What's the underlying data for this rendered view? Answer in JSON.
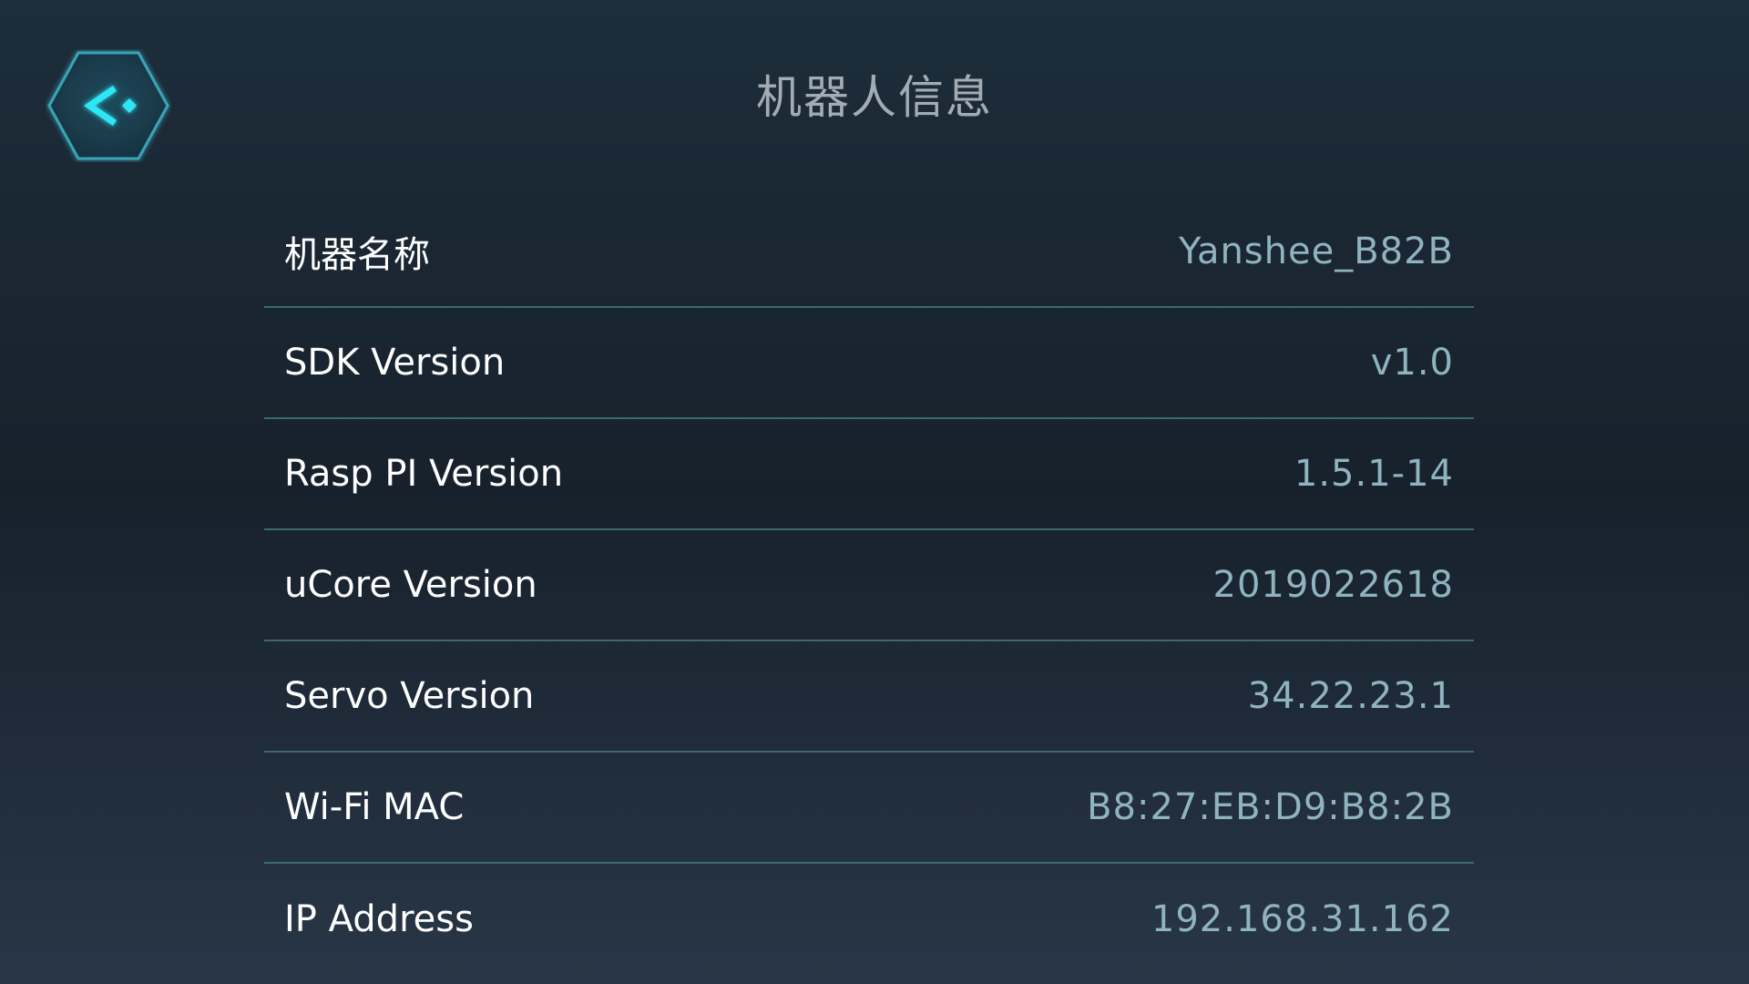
{
  "header": {
    "title": "机器人信息",
    "back_icon": "back-arrow-icon",
    "accent_color": "#2fe6f5"
  },
  "info": {
    "items": [
      {
        "label": "机器名称",
        "value": "Yanshee_B82B"
      },
      {
        "label": "SDK Version",
        "value": "v1.0"
      },
      {
        "label": "Rasp PI Version",
        "value": "1.5.1-14"
      },
      {
        "label": "uCore Version",
        "value": "2019022618"
      },
      {
        "label": "Servo Version",
        "value": "34.22.23.1"
      },
      {
        "label": "Wi-Fi MAC",
        "value": "B8:27:EB:D9:B8:2B"
      },
      {
        "label": "IP Address",
        "value": "192.168.31.162"
      }
    ]
  }
}
